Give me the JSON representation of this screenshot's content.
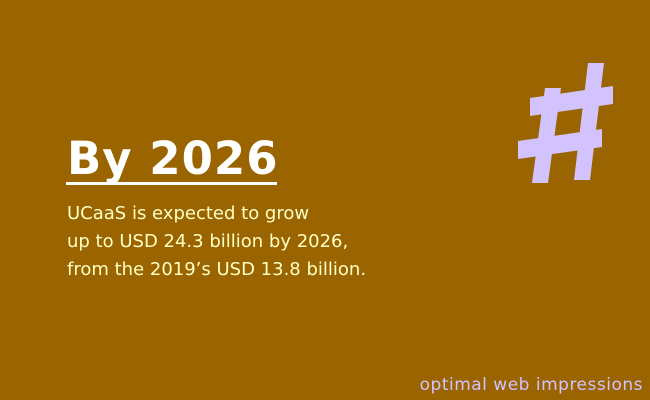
{
  "headline": "By 2026",
  "body_lines": [
    "UCaaS is expected to grow",
    "up to USD 24.3 billion by 2026,",
    "from the 2019’s USD 13.8 billion."
  ],
  "watermark": "optimal web impressions",
  "icons": {
    "hash": "hash-icon"
  },
  "colors": {
    "background": "#9a6500",
    "headline": "#ffffff",
    "body_text": "#ffffc4",
    "accent": "#d2c3ff"
  }
}
